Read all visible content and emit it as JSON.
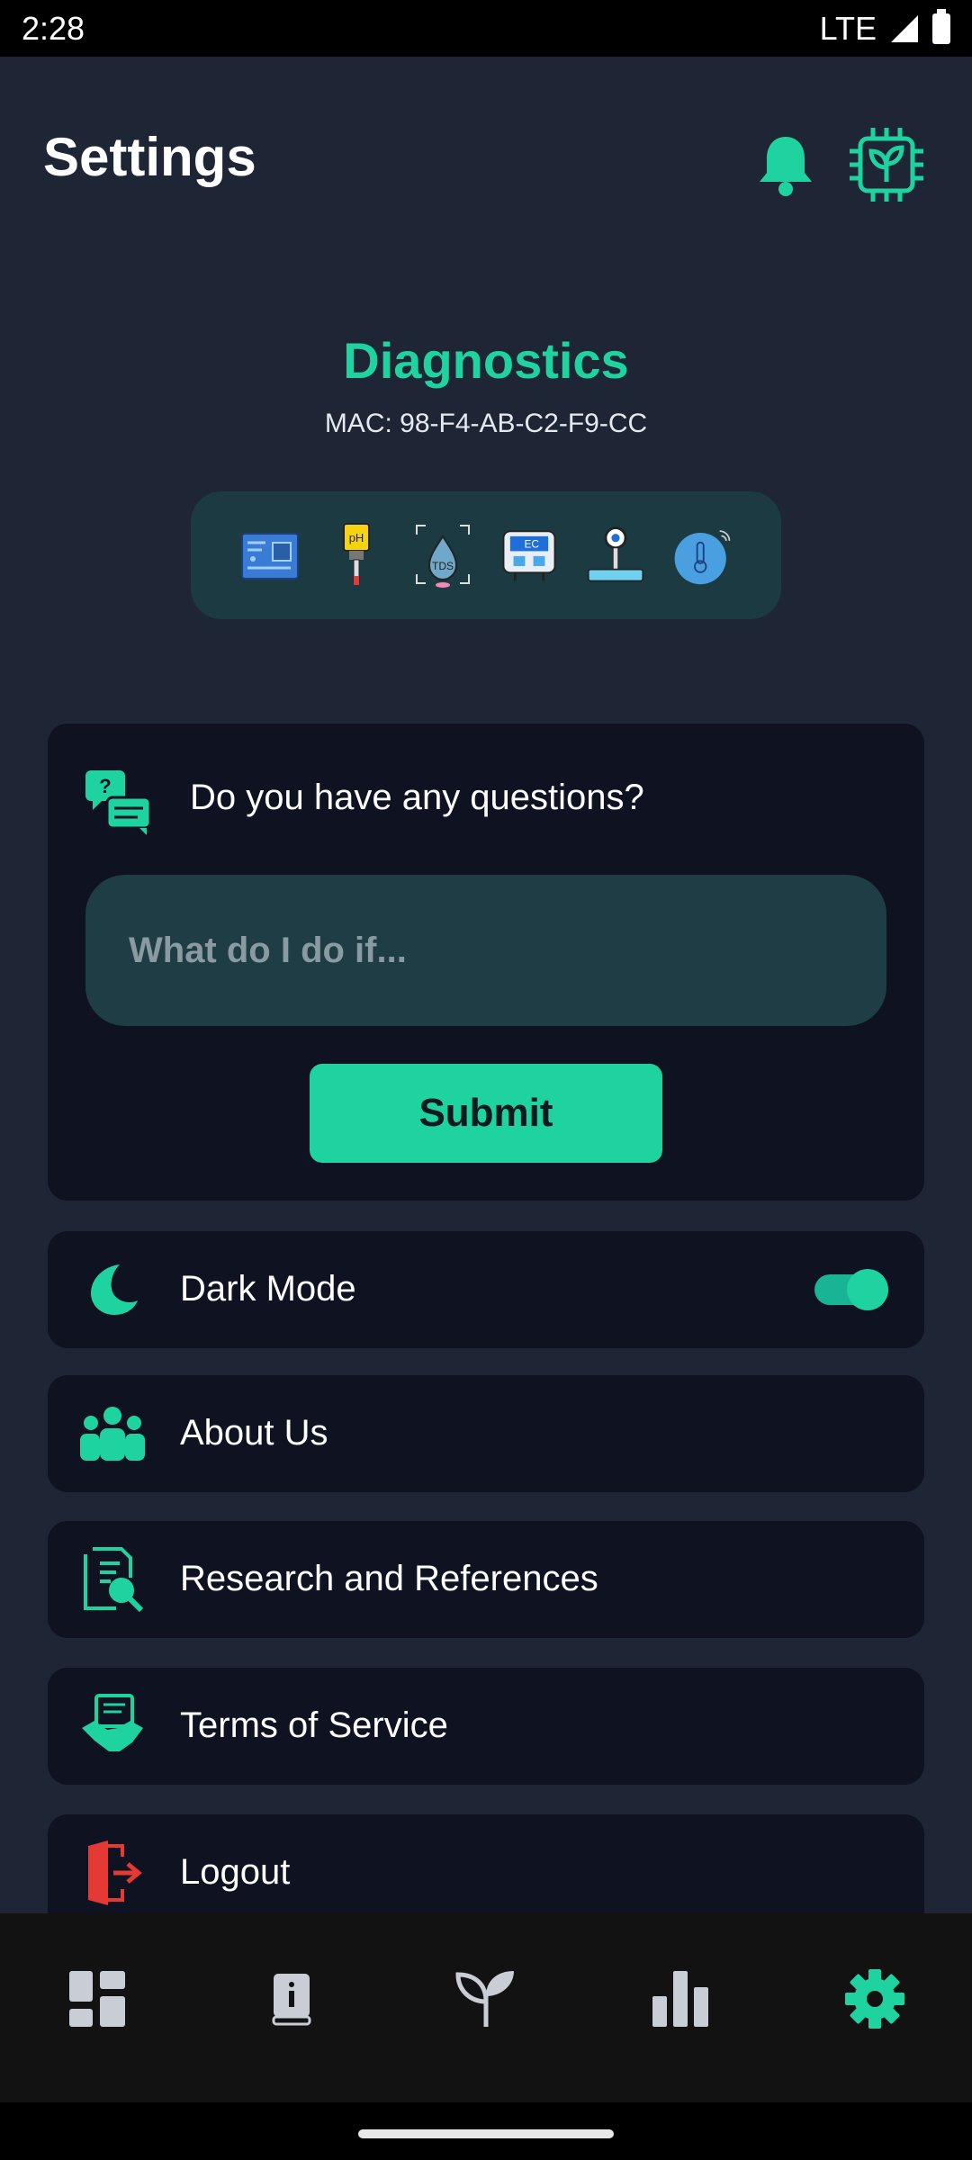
{
  "status_bar": {
    "time": "2:28",
    "network": "LTE"
  },
  "header": {
    "title": "Settings",
    "bell_icon": "bell-icon",
    "device_icon": "chip-plant-icon"
  },
  "diagnostics": {
    "title": "Diagnostics",
    "mac": "MAC: 98-F4-AB-C2-F9-CC",
    "sensors": [
      "circuit-board-icon",
      "ph-meter-icon",
      "tds-drop-icon",
      "ec-meter-icon",
      "water-level-icon",
      "temperature-sensor-icon"
    ]
  },
  "questions": {
    "title": "Do you have any questions?",
    "placeholder": "What do I do if...",
    "value": "",
    "submit_label": "Submit"
  },
  "menu": {
    "dark_mode": {
      "label": "Dark Mode",
      "enabled": true
    },
    "about": {
      "label": "About Us"
    },
    "research": {
      "label": "Research and References"
    },
    "terms": {
      "label": "Terms of Service"
    },
    "logout": {
      "label": "Logout"
    }
  },
  "bottom_nav": {
    "items": [
      "dashboard-icon",
      "journal-icon",
      "plant-icon",
      "bar-chart-icon",
      "settings-gear-icon"
    ],
    "active": "settings-gear-icon"
  },
  "colors": {
    "accent": "#1ed3a0",
    "background": "#1e2535",
    "card": "#0f1220",
    "inactive_nav": "#c8cdd6",
    "logout_red": "#e53935"
  }
}
